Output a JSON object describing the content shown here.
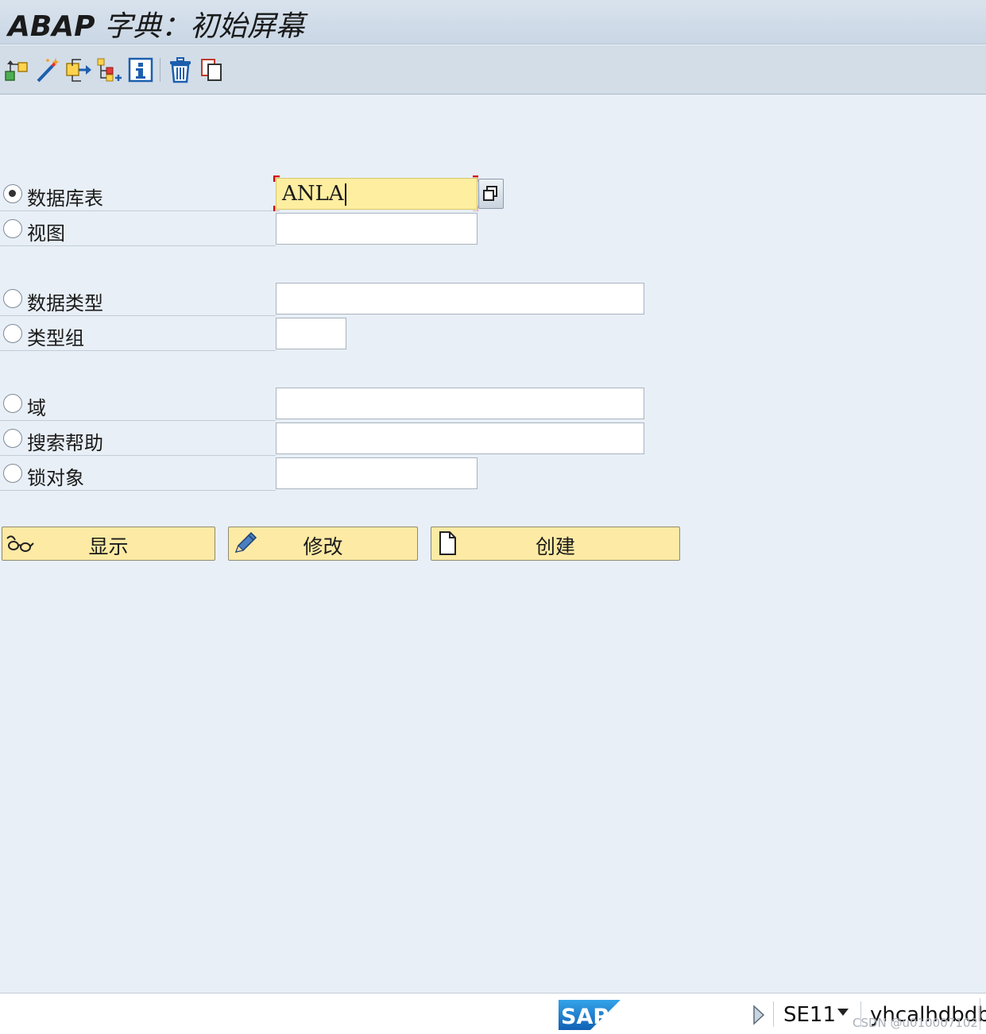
{
  "window": {
    "title_prefix": "ABAP",
    "title_rest": " 字典：初始屏幕"
  },
  "toolbar": {
    "icons": [
      "other-object-icon",
      "wizard-icon",
      "where-used-icon",
      "hierarchy-icon",
      "info-icon",
      "delete-icon",
      "copy-icon"
    ]
  },
  "options": [
    {
      "label": "数据库表",
      "value": "ANLA",
      "selected": true
    },
    {
      "label": "视图",
      "value": "",
      "selected": false
    },
    {
      "label": "数据类型",
      "value": "",
      "selected": false
    },
    {
      "label": "类型组",
      "value": "",
      "selected": false
    },
    {
      "label": "域",
      "value": "",
      "selected": false
    },
    {
      "label": "搜索帮助",
      "value": "",
      "selected": false
    },
    {
      "label": "锁对象",
      "value": "",
      "selected": false
    }
  ],
  "buttons": {
    "display": "显示",
    "change": "修改",
    "create": "创建"
  },
  "status": {
    "logo": "SAP",
    "transaction": "SE11",
    "user": "yhcalhdbdb",
    "watermark": "CSDN @u010007102"
  },
  "colors": {
    "background": "#e8eff6",
    "active_field": "#fdeea0",
    "button": "#fdeaa4",
    "sap_blue": "#1c6fbf"
  }
}
